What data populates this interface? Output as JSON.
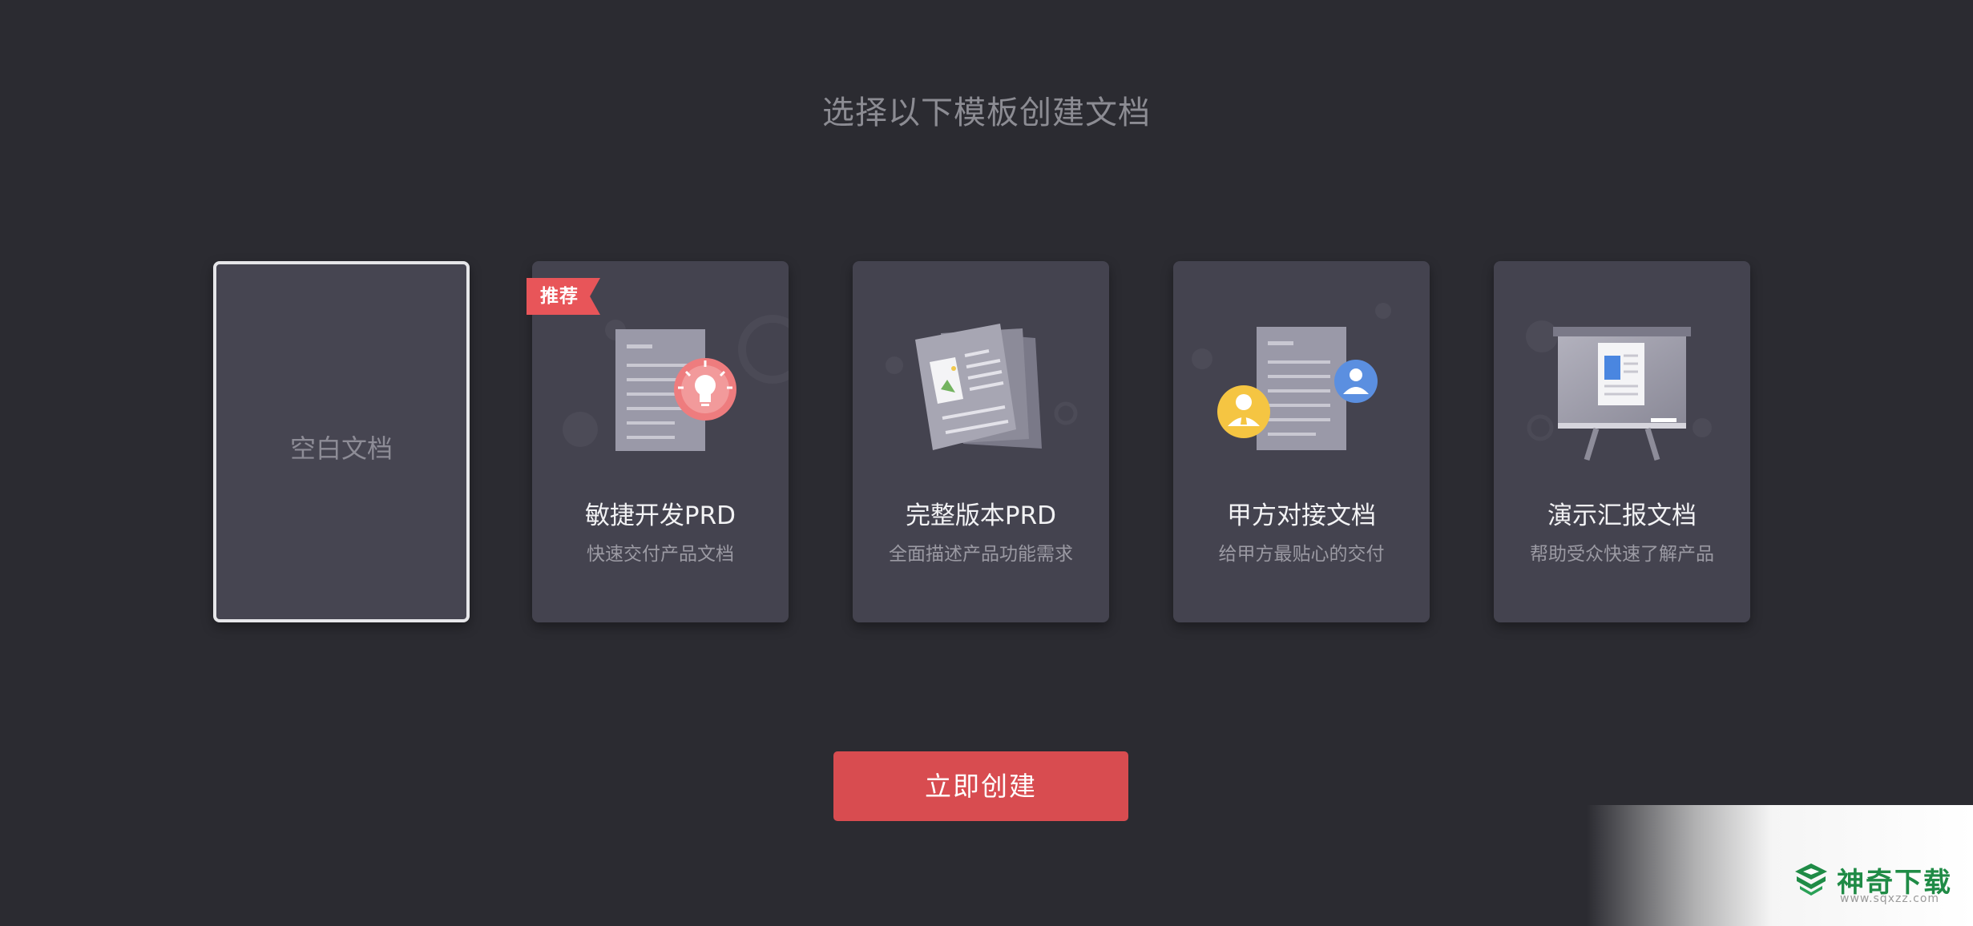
{
  "page": {
    "title": "选择以下模板创建文档"
  },
  "templates": [
    {
      "id": "blank",
      "label": "空白文档",
      "selected": true
    },
    {
      "id": "agile-prd",
      "title": "敏捷开发PRD",
      "desc": "快速交付产品文档",
      "badge": "推荐",
      "icon": "document-lightbulb-icon"
    },
    {
      "id": "full-prd",
      "title": "完整版本PRD",
      "desc": "全面描述产品功能需求",
      "icon": "document-stack-image-icon"
    },
    {
      "id": "client-doc",
      "title": "甲方对接文档",
      "desc": "给甲方最贴心的交付",
      "icon": "document-people-icon"
    },
    {
      "id": "presentation",
      "title": "演示汇报文档",
      "desc": "帮助受众快速了解产品",
      "icon": "presentation-board-icon"
    }
  ],
  "actions": {
    "create_label": "立即创建"
  },
  "watermark": {
    "text": "神奇下载",
    "url": "www.sqxzz.com"
  },
  "colors": {
    "background": "#2b2b31",
    "card": "#44434f",
    "accent": "#d84c50",
    "badge": "#e85559"
  }
}
